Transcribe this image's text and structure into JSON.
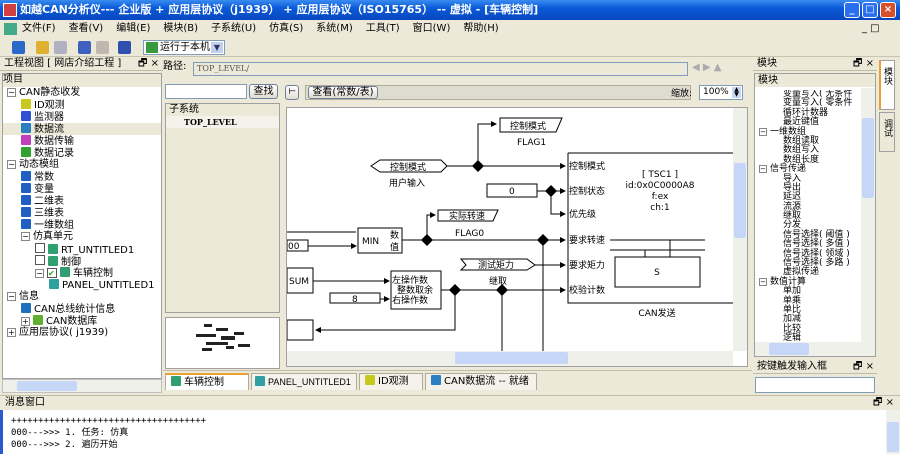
{
  "window": {
    "title": "如越CAN分析仪--- 企业版 + 应用层协议（j1939） + 应用层协议（ISO15765） -- 虚拟 - [车辆控制]",
    "minimize": "_",
    "maximize": "□",
    "close": "×"
  },
  "menu": [
    "文件(F)",
    "查看(V)",
    "编辑(E)",
    "模块(B)",
    "子系统(U)",
    "仿真(S)",
    "系统(M)",
    "工具(T)",
    "窗口(W)",
    "帮助(H)"
  ],
  "toolbar": {
    "run_target": "运行于本机"
  },
  "project": {
    "title": "工程视图 [ 网店介绍工程 ]",
    "header": "项目",
    "items": [
      {
        "label": "CAN静态收发",
        "level": 0,
        "exp": "−",
        "color": ""
      },
      {
        "label": "ID观测",
        "level": 1,
        "color": "#c8c820"
      },
      {
        "label": "监测器",
        "level": 1,
        "color": "#3050d0"
      },
      {
        "label": "数据流",
        "level": 1,
        "color": "#2a80c0"
      },
      {
        "label": "数据传输",
        "level": 1,
        "color": "#c040c0"
      },
      {
        "label": "数据记录",
        "level": 1,
        "color": "#30a030"
      },
      {
        "label": "动态模组",
        "level": 0,
        "exp": "−",
        "color": ""
      },
      {
        "label": "常数",
        "level": 1,
        "color": "#2060c0"
      },
      {
        "label": "变量",
        "level": 1,
        "color": "#2060c0"
      },
      {
        "label": "二维表",
        "level": 1,
        "color": "#2060c0"
      },
      {
        "label": "三维表",
        "level": 1,
        "color": "#2060c0"
      },
      {
        "label": "一维数组",
        "level": 1,
        "color": "#2060c0"
      },
      {
        "label": "仿真单元",
        "level": 1,
        "exp": "−",
        "color": ""
      },
      {
        "label": "RT_UNTITLED1",
        "level": 2,
        "check": false,
        "color": "#30a070"
      },
      {
        "label": "制御",
        "level": 2,
        "check": false,
        "color": "#30a070"
      },
      {
        "label": "车辆控制",
        "level": 2,
        "check": true,
        "exp": "−",
        "color": "#30a070"
      },
      {
        "label": "PANEL_UNTITLED1",
        "level": 3,
        "color": "#30a0a0"
      },
      {
        "label": "信息",
        "level": 0,
        "exp": "−",
        "color": ""
      },
      {
        "label": "CAN总线统计信息",
        "level": 1,
        "color": "#2070c0"
      },
      {
        "label": "CAN数据库",
        "level": 1,
        "exp": "+",
        "color": "#60b030"
      },
      {
        "label": "应用层协议( j1939)",
        "level": 0,
        "exp": "+",
        "color": ""
      }
    ]
  },
  "path": {
    "label": "路径:",
    "value": "TOP_LEVEL/"
  },
  "search": {
    "value": "",
    "button": "查找"
  },
  "subsystem": {
    "header": "子系统",
    "items": [
      "TOP_LEVEL"
    ]
  },
  "diagram_toolbar": {
    "view_button": "查看(常数/表)",
    "zoom_label": "缩放:",
    "zoom_value": "100%"
  },
  "diagram": {
    "flag1_label": "控制模式",
    "flag1_name": "FLAG1",
    "user_input_label": "控制模式",
    "user_input_name": "用户输入",
    "const0": "0",
    "flag0_label": "实际转速",
    "flag0_name": "FLAG0",
    "min_label": "MIN",
    "min_sub1": "数",
    "min_sub2": "值",
    "const_left": "00",
    "test_label": "测试矩力",
    "test_name": "继取",
    "sum_label": "SUM",
    "mod_l1": "左操作数",
    "mod_l2": "整数取余",
    "mod_l3": "右操作数",
    "const8": "8",
    "can_ports": [
      "控制模式",
      "控制状态",
      "优先级",
      "要求转速",
      "要求矩力",
      "校验计数"
    ],
    "can_info": [
      "[ TSC1 ]",
      "id:0x0C0000A8",
      "f:ex",
      "ch:1"
    ],
    "s_label": "S",
    "can_name": "CAN发送"
  },
  "tabs": [
    "车辆控制",
    "PANEL_UNTITLED1",
    "ID观测",
    "CAN数据流 -- 就绪"
  ],
  "modules": {
    "title": "模块",
    "header": "模块",
    "items": [
      {
        "label": "变量写入( 无条件",
        "level": 2
      },
      {
        "label": "变量写入( 零条件",
        "level": 2
      },
      {
        "label": "循环计数器",
        "level": 2
      },
      {
        "label": "最近键值",
        "level": 2
      },
      {
        "label": "一维数组",
        "level": 1,
        "exp": "−"
      },
      {
        "label": "数组读取",
        "level": 2
      },
      {
        "label": "数组写入",
        "level": 2
      },
      {
        "label": "数组长度",
        "level": 2
      },
      {
        "label": "信号传递",
        "level": 1,
        "exp": "−"
      },
      {
        "label": "导入",
        "level": 2
      },
      {
        "label": "导出",
        "level": 2
      },
      {
        "label": "延迟",
        "level": 2
      },
      {
        "label": "流源",
        "level": 2
      },
      {
        "label": "继取",
        "level": 2
      },
      {
        "label": "分发",
        "level": 2
      },
      {
        "label": "信号选择( 阈值 )",
        "level": 2
      },
      {
        "label": "信号选择( 多值 )",
        "level": 2
      },
      {
        "label": "信号选择( 领域 )",
        "level": 2
      },
      {
        "label": "信号选择( 多路 )",
        "level": 2
      },
      {
        "label": "虚拟传递",
        "level": 2
      },
      {
        "label": "数值计算",
        "level": 1,
        "exp": "−"
      },
      {
        "label": "单加",
        "level": 2
      },
      {
        "label": "单乘",
        "level": 2
      },
      {
        "label": "单比",
        "level": 2
      },
      {
        "label": "加减",
        "level": 2
      },
      {
        "label": "比较",
        "level": 2
      },
      {
        "label": "逻辑",
        "level": 2
      }
    ]
  },
  "side_tabs": [
    "模块",
    "调试"
  ],
  "key_input": {
    "title": "按键触发输入框",
    "value": ""
  },
  "messages": {
    "title": "消息窗口",
    "lines": [
      "++++++++++++++++++++++++++++++++++++",
      "000--->>> 1.  任务: 仿真",
      "000--->>> 2.  遍历开始"
    ]
  }
}
